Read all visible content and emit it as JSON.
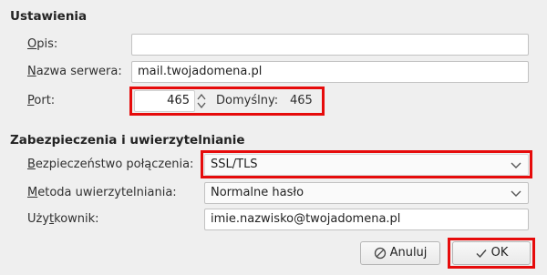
{
  "settings": {
    "heading": "Ustawienia",
    "description": {
      "label_prefix": "",
      "label_key": "O",
      "label_rest": "pis:",
      "value": ""
    },
    "server_name": {
      "label_key": "N",
      "label_rest": "azwa serwera:",
      "value": "mail.twojadomena.pl"
    },
    "port": {
      "label_key": "P",
      "label_rest": "ort:",
      "value": "465",
      "default_label": "Domyślny:",
      "default_value": "465"
    }
  },
  "security": {
    "heading": "Zabezpieczenia i uwierzytelnianie",
    "connection_security": {
      "label_key": "B",
      "label_rest": "ezpieczeństwo połączenia:",
      "value": "SSL/TLS"
    },
    "auth_method": {
      "label_key": "M",
      "label_rest": "etoda uwierzytelniania:",
      "value": "Normalne hasło"
    },
    "username": {
      "label_pre": "Uży",
      "label_key": "t",
      "label_rest": "kownik:",
      "value": "imie.nazwisko@twojadomena.pl"
    }
  },
  "buttons": {
    "cancel": {
      "label": "Anuluj",
      "icon": "cancel-icon"
    },
    "ok": {
      "label": "OK",
      "icon": "checkmark-icon"
    }
  },
  "colors": {
    "highlight": "#e60b0b",
    "background": "#efefef"
  }
}
